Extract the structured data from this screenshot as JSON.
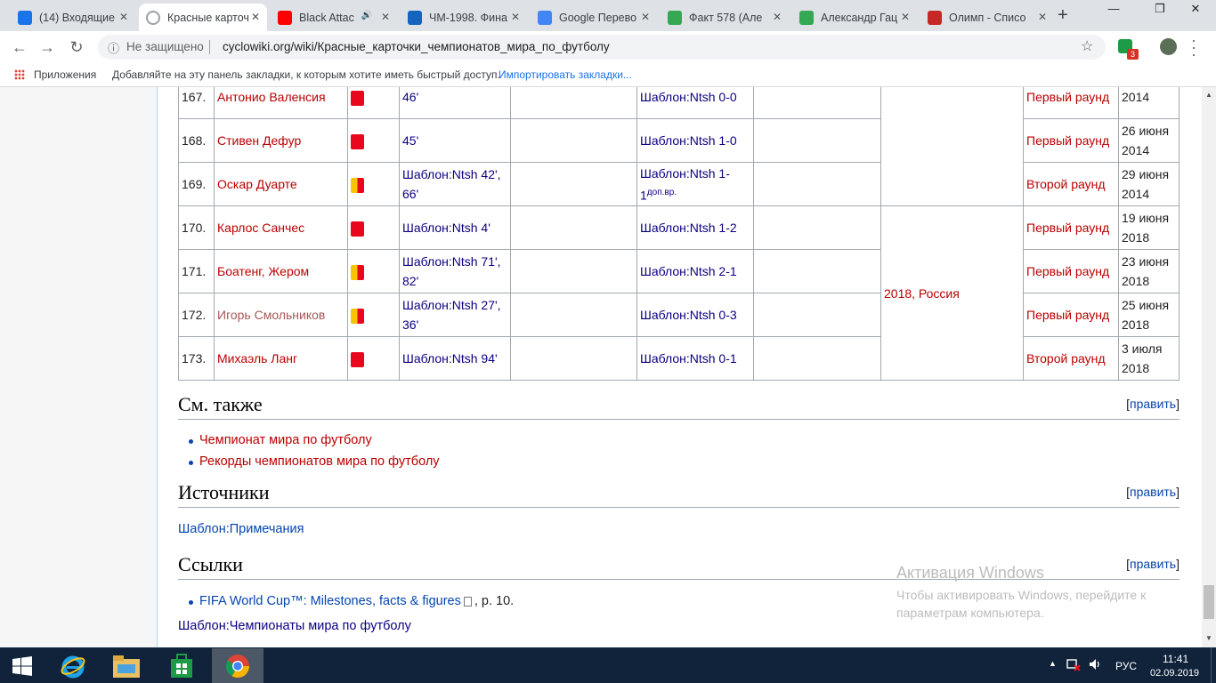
{
  "browser": {
    "tabs": [
      {
        "label": "(14) Входящие",
        "icon": "mail-icon",
        "icon_color": "#1a73e8"
      },
      {
        "label": "Красные карточ",
        "icon": "cyclowiki-icon",
        "icon_color": "#9aa0a6"
      },
      {
        "label": "Black Attac",
        "icon": "youtube-icon",
        "icon_color": "#ff0000"
      },
      {
        "label": "ЧМ-1998. Фина",
        "icon": "sb-icon",
        "icon_color": "#1565c0"
      },
      {
        "label": "Google Перево",
        "icon": "google-translate-icon",
        "icon_color": "#4285f4"
      },
      {
        "label": "Факт 578 (Але",
        "icon": "sheets-icon",
        "icon_color": "#34a853"
      },
      {
        "label": "Александр Гац",
        "icon": "sheets-icon",
        "icon_color": "#34a853"
      },
      {
        "label": "Олимп - Списо",
        "icon": "olimp-icon",
        "icon_color": "#c62828"
      }
    ],
    "security": "Не защищено",
    "url": "cyclowiki.org/wiki/Красные_карточки_чемпионатов_мира_по_футболу",
    "ext_badge": "3",
    "bookmarks": {
      "apps": "Приложения",
      "hint": "Добавляйте на эту панель закладки, к которым хотите иметь быстрый доступ.",
      "import": "Импортировать закладки..."
    }
  },
  "table": {
    "rows": [
      {
        "num": "167.",
        "name": "Антонио Валенсия",
        "card": "red",
        "minute": "46'",
        "score": "Шаблон:Ntsh 0-0",
        "round": "Первый раунд",
        "date": "2014"
      },
      {
        "num": "168.",
        "name": "Стивен Дефур",
        "card": "red",
        "minute": "45'",
        "score": "Шаблон:Ntsh 1-0",
        "round": "Первый раунд",
        "date": "26 июня 2014"
      },
      {
        "num": "169.",
        "name": "Оскар Дуарте",
        "card": "yr",
        "minute": "Шаблон:Ntsh 42', 66'",
        "score": "Шаблон:Ntsh 1-1",
        "score_sup": "доп.вр.",
        "round": "Второй раунд",
        "date": "29 июня 2014"
      },
      {
        "num": "170.",
        "name": "Карлос Санчес",
        "card": "red",
        "minute": "Шаблон:Ntsh 4'",
        "score": "Шаблон:Ntsh 1-2",
        "round": "Первый раунд",
        "date": "19 июня 2018"
      },
      {
        "num": "171.",
        "name": "Боатенг, Жером",
        "card": "yr",
        "minute": "Шаблон:Ntsh 71', 82'",
        "score": "Шаблон:Ntsh 2-1",
        "round": "Первый раунд",
        "date": "23 июня 2018"
      },
      {
        "num": "172.",
        "name": "Игорь Смольников",
        "card": "yr",
        "minute": "Шаблон:Ntsh 27', 36'",
        "score": "Шаблон:Ntsh 0-3",
        "round": "Первый раунд",
        "date": "25 июня 2018"
      },
      {
        "num": "173.",
        "name": "Михаэль Ланг",
        "card": "red",
        "minute": "Шаблон:Ntsh 94'",
        "score": "Шаблон:Ntsh 0-1",
        "round": "Второй раунд",
        "date": "3 июля 2018"
      }
    ],
    "tournament_2018": "2018, Россия"
  },
  "sections": {
    "see_also": {
      "title": "См. также",
      "items": [
        "Чемпионат мира по футболу",
        "Рекорды чемпионатов мира по футболу"
      ]
    },
    "sources": {
      "title": "Источники",
      "template": "Шаблон:Примечания"
    },
    "links": {
      "title": "Ссылки",
      "item_link": "FIFA World Cup™: Milestones, facts & figures",
      "item_tail": ", p. 10.",
      "template": "Шаблон:Чемпионаты мира по футболу"
    },
    "edit_open": "[",
    "edit_label": "править",
    "edit_close": "]"
  },
  "watermark": {
    "title": "Активация Windows",
    "text": "Чтобы активировать Windows, перейдите к параметрам компьютера."
  },
  "taskbar": {
    "lang": "РУС",
    "time": "11:41",
    "date": "02.09.2019"
  }
}
